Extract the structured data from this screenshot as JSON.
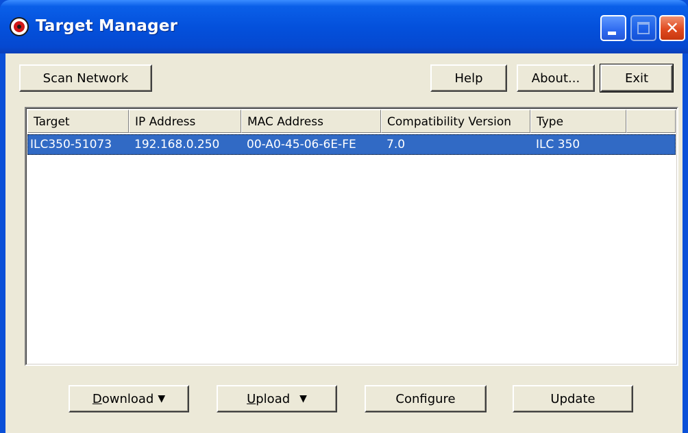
{
  "window": {
    "title": "Target Manager",
    "colors": {
      "titlebar": "#0451dc",
      "face": "#ece9d8",
      "selection": "#316ac5",
      "close": "#e04a20"
    }
  },
  "title_buttons": {
    "minimize": "minimize-icon",
    "maximize": "maximize-icon",
    "close": "close-icon"
  },
  "toolbar": {
    "scan_label": "Scan Network",
    "help_label": "Help",
    "about_label": "About...",
    "exit_label": "Exit"
  },
  "table": {
    "columns": [
      "Target",
      "IP Address",
      "MAC Address",
      "Compatibility Version",
      "Type"
    ],
    "rows": [
      {
        "target": "ILC350-51073",
        "ip": "192.168.0.250",
        "mac": "00-A0-45-06-6E-FE",
        "compat": "7.0",
        "type": "ILC 350",
        "selected": true
      }
    ]
  },
  "actions": {
    "download_label": "Download",
    "download_mnemonic": "D",
    "upload_label": "Upload",
    "upload_mnemonic": "U",
    "configure_label": "Configure",
    "update_label": "Update",
    "dropdown_icon": "caret-down-icon"
  }
}
